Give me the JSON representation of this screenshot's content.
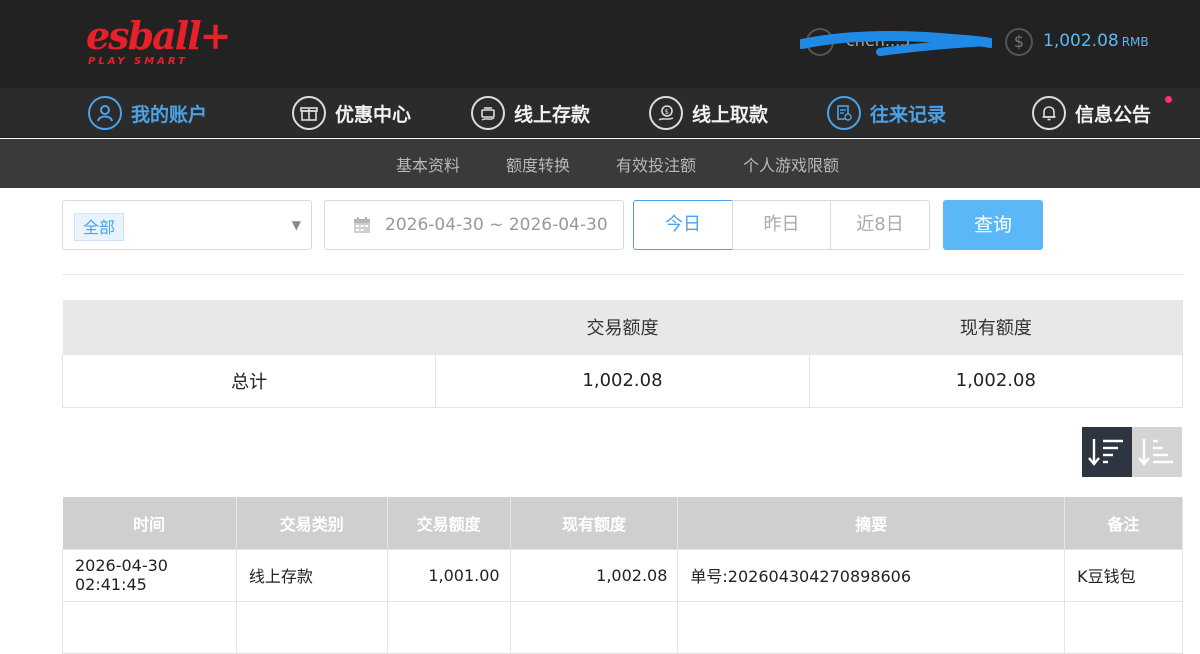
{
  "header": {
    "logo_text": "esball+",
    "logo_tagline": "PLAY SMART",
    "username": "chen...3",
    "balance": "1,002.08",
    "currency": "RMB"
  },
  "nav": {
    "items": [
      {
        "label": "我的账户",
        "icon": "user-icon",
        "active": true
      },
      {
        "label": "优惠中心",
        "icon": "gift-icon",
        "active": false
      },
      {
        "label": "线上存款",
        "icon": "deposit-icon",
        "active": false
      },
      {
        "label": "线上取款",
        "icon": "withdraw-icon",
        "active": false
      },
      {
        "label": "往来记录",
        "icon": "records-icon",
        "active": true
      },
      {
        "label": "信息公告",
        "icon": "bell-icon",
        "active": false
      }
    ]
  },
  "subnav": {
    "items": [
      "基本资料",
      "额度转换",
      "有效投注额",
      "个人游戏限额"
    ]
  },
  "filters": {
    "type_selected": "全部",
    "date_range": "2026-04-30 ~ 2026-04-30",
    "quick": [
      "今日",
      "昨日",
      "近8日"
    ],
    "query_label": "查询"
  },
  "summary": {
    "headers": [
      "",
      "交易额度",
      "现有额度"
    ],
    "row": [
      "总计",
      "1,002.08",
      "1,002.08"
    ]
  },
  "records": {
    "headers": [
      "时间",
      "交易类别",
      "交易额度",
      "现有额度",
      "摘要",
      "备注"
    ],
    "rows": [
      [
        "2026-04-30 02:41:45",
        "线上存款",
        "1,001.00",
        "1,002.08",
        "单号:202604304270898606",
        "K豆钱包"
      ]
    ]
  },
  "colors": {
    "accent": "#4aa3e8",
    "brand": "#e8202a",
    "balance": "#5bb8f0",
    "notify": "#ff3366"
  }
}
